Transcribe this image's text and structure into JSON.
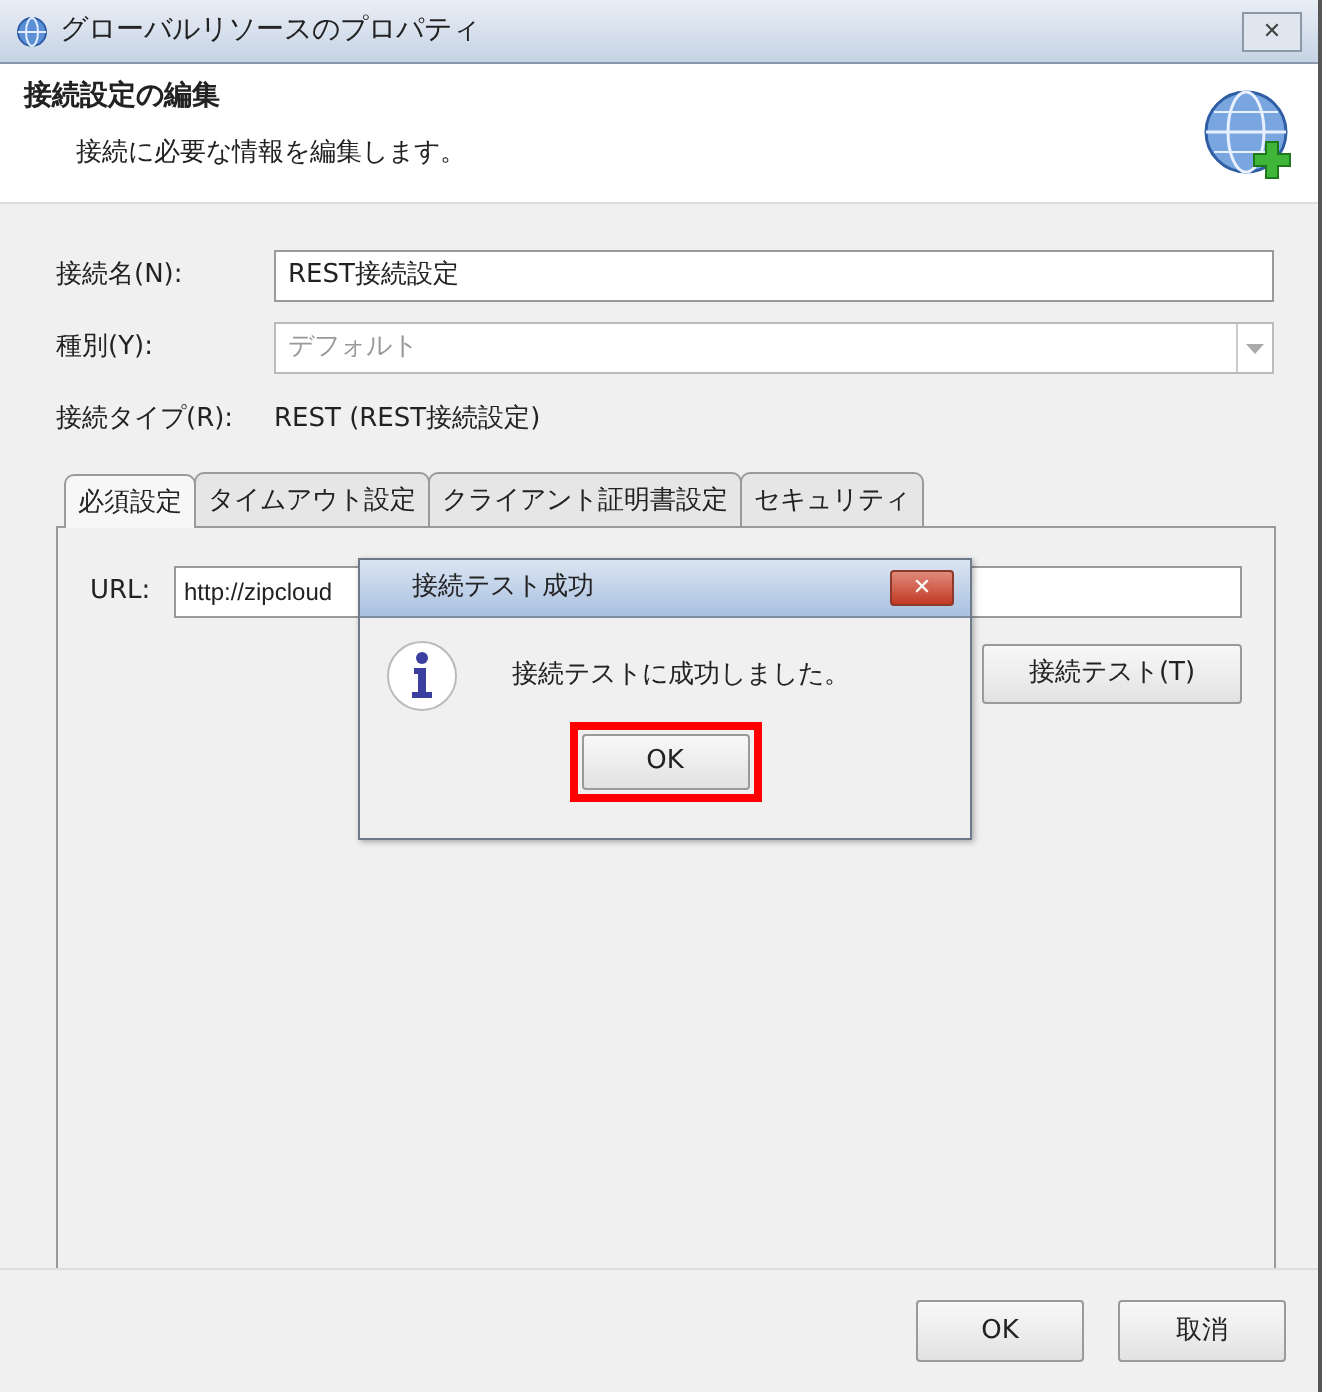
{
  "window": {
    "title": "グローバルリソースのプロパティ",
    "close": "✕"
  },
  "header": {
    "title": "接続設定の編集",
    "description": "接続に必要な情報を編集します。"
  },
  "fields": [
    {
      "kind": "text",
      "label": "接続名(N):",
      "value": "REST接続設定"
    },
    {
      "kind": "select",
      "label": "種別(Y):",
      "value": "デフォルト",
      "disabled": true
    },
    {
      "kind": "static",
      "label": "接続タイプ(R):",
      "value": "REST (REST接続設定)"
    }
  ],
  "tabs": [
    {
      "label": "必須設定",
      "selected": true
    },
    {
      "label": "タイムアウト設定",
      "selected": false
    },
    {
      "label": "クライアント証明書設定",
      "selected": false
    },
    {
      "label": "セキュリティ",
      "selected": false
    }
  ],
  "url": {
    "label": "URL:",
    "value": "http://zipcloud"
  },
  "test_button": "接続テスト(T)",
  "dialog": {
    "title": "接続テスト成功",
    "close": "✕",
    "message": "接続テストに成功しました。",
    "button": "OK",
    "highlighted": true
  },
  "buttons": [
    "OK",
    "取消"
  ]
}
